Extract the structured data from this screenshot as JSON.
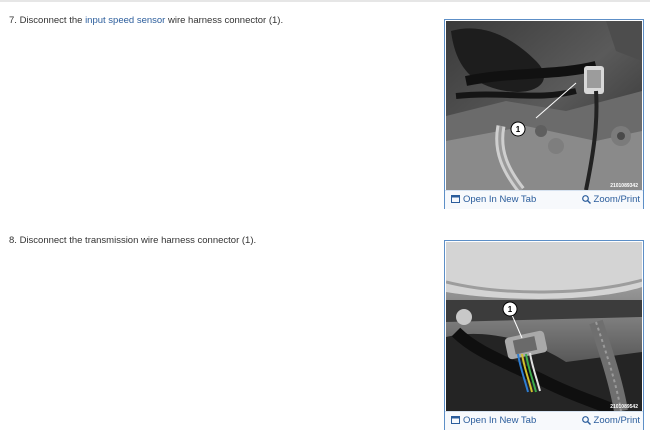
{
  "steps": [
    {
      "number": "7.",
      "text_before": "Disconnect the",
      "link_text": "input speed sensor",
      "text_after": "wire harness connector (1).",
      "figure": {
        "callout": "1",
        "part_number": "2101089342",
        "open_label": "Open In New Tab",
        "zoom_label": "Zoom/Print"
      }
    },
    {
      "number": "8.",
      "text": "Disconnect the transmission wire harness connector (1).",
      "figure": {
        "callout": "1",
        "part_number": "2101089542",
        "open_label": "Open In New Tab",
        "zoom_label": "Zoom/Print"
      }
    }
  ],
  "icons": {
    "open_tab": "open-in-new-tab-icon",
    "zoom": "magnifier-icon"
  },
  "colors": {
    "link": "#2b5d9c",
    "figure_border": "#5d8fc7",
    "body_text": "#333333"
  }
}
